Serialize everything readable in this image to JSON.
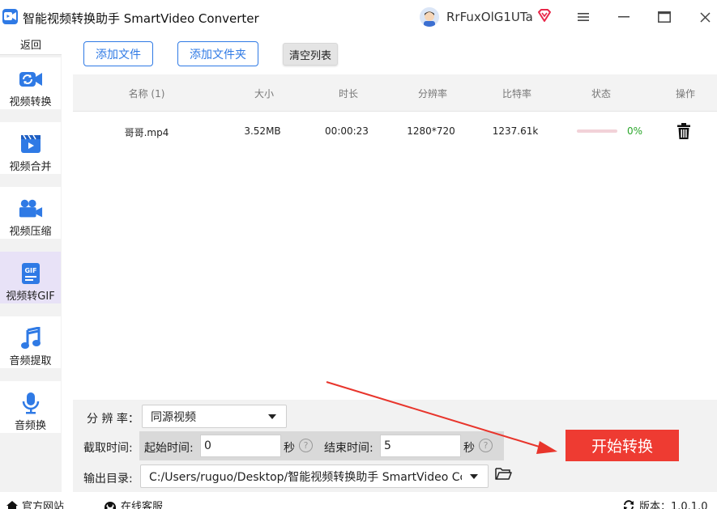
{
  "app": {
    "title": "智能视频转换助手 SmartVideo Converter",
    "user_name": "RrFuxOlG1UTa"
  },
  "sidebar": {
    "back_label": "返回",
    "items": [
      {
        "label": "视频转换",
        "icon": "video-convert-icon"
      },
      {
        "label": "视频合并",
        "icon": "video-merge-icon"
      },
      {
        "label": "视频压缩",
        "icon": "video-compress-icon"
      },
      {
        "label": "视频转GIF",
        "icon": "gif-icon",
        "active": true
      },
      {
        "label": "音频提取",
        "icon": "music-note-icon"
      },
      {
        "label": "音频换",
        "icon": "microphone-icon"
      }
    ]
  },
  "toolbar": {
    "add_file": "添加文件",
    "add_folder": "添加文件夹",
    "clear_list": "清空列表"
  },
  "table": {
    "headers": [
      "名称 (1)",
      "大小",
      "时长",
      "分辨率",
      "比特率",
      "状态",
      "操作"
    ],
    "rows": [
      {
        "name": "哥哥.mp4",
        "size": "3.52MB",
        "duration": "00:00:23",
        "resolution": "1280*720",
        "bitrate": "1237.61k",
        "progress": 0,
        "progress_text": "0%"
      }
    ]
  },
  "settings": {
    "resolution_label": "分 辨 率：",
    "resolution_value": "同源视频",
    "clip_label": "截取时间:",
    "start_label": "起始时间:",
    "start_value": "0",
    "seconds_unit": "秒",
    "end_label": "结束时间:",
    "end_value": "5",
    "output_label": "输出目录:",
    "output_path": "C:/Users/ruguo/Desktop/智能视频转换助手 SmartVideo Cc",
    "help_glyph": "?"
  },
  "actions": {
    "start_label": "开始转换"
  },
  "statusbar": {
    "website": "官方网站",
    "support": "在线客服",
    "version": "版本：1.0.1.0"
  },
  "colors": {
    "accent": "#2f7ae5",
    "start_button": "#ee3b32",
    "active_nav": "#e8e2f7",
    "progress": "#e86a86",
    "success": "#2aa62a"
  }
}
